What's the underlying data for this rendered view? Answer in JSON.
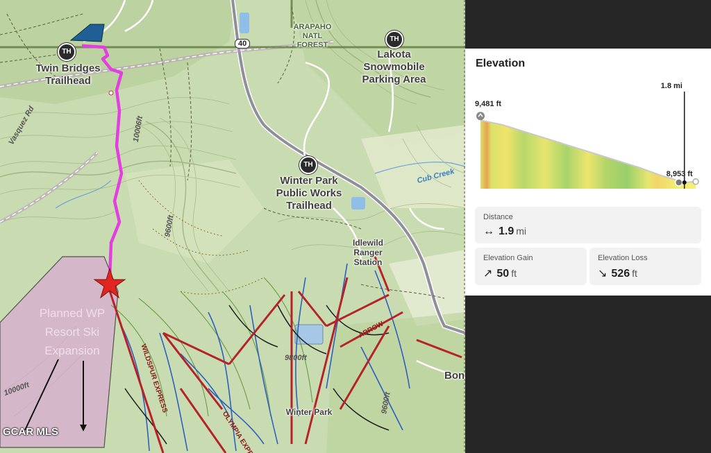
{
  "map": {
    "labels": {
      "twin_bridges": "Twin Bridges\nTrailhead",
      "arapaho": "ARAPAHO\nNATL\nFOREST",
      "lakota": "Lakota\nSnowmobile\nParking Area",
      "public_works": "Winter Park\nPublic Works\nTrailhead",
      "idlewild": "Idlewild\nRanger\nStation",
      "winter_park": "Winter Park",
      "bon": "Bon",
      "cub_creek": "Cub Creek",
      "vasquez": "Vasquez Rd",
      "highway": "40",
      "wildspur": "WILDSPUR EXPRESS",
      "olympia": "OLYMPIA EXPR",
      "arrow": "ARROW",
      "contour_9800": "9800ft",
      "contour_9600": "9600ft",
      "contour_10000": "10000ft",
      "contour_9600b": "9600ft",
      "contour_10006": "10006ft",
      "trailhead_badge": "TH"
    },
    "expansion_text": "Planned WP\nResort Ski\nExpansion",
    "watermark": "GCAR MLS"
  },
  "elevation_panel": {
    "title": "Elevation",
    "marker_label": "1.8 mi",
    "start_label": "9,481 ft",
    "end_label": "8,953 ft",
    "stats": {
      "distance": {
        "label": "Distance",
        "arrow": "↔",
        "value": "1.9",
        "unit": "mi"
      },
      "gain": {
        "label": "Elevation Gain",
        "arrow": "↗",
        "value": "50",
        "unit": "ft"
      },
      "loss": {
        "label": "Elevation Loss",
        "arrow": "↘",
        "value": "526",
        "unit": "ft"
      }
    }
  },
  "chart_data": {
    "type": "area",
    "x": [
      0,
      0.2,
      0.4,
      0.6,
      0.8,
      1.0,
      1.2,
      1.4,
      1.6,
      1.8,
      1.9
    ],
    "values": [
      9481,
      9440,
      9380,
      9320,
      9260,
      9200,
      9140,
      9080,
      9010,
      8953,
      8960
    ],
    "title": "Elevation",
    "xlabel": "",
    "ylabel": "",
    "annotations": [
      "9,481 ft",
      "8,953 ft",
      "1.8 mi"
    ]
  }
}
